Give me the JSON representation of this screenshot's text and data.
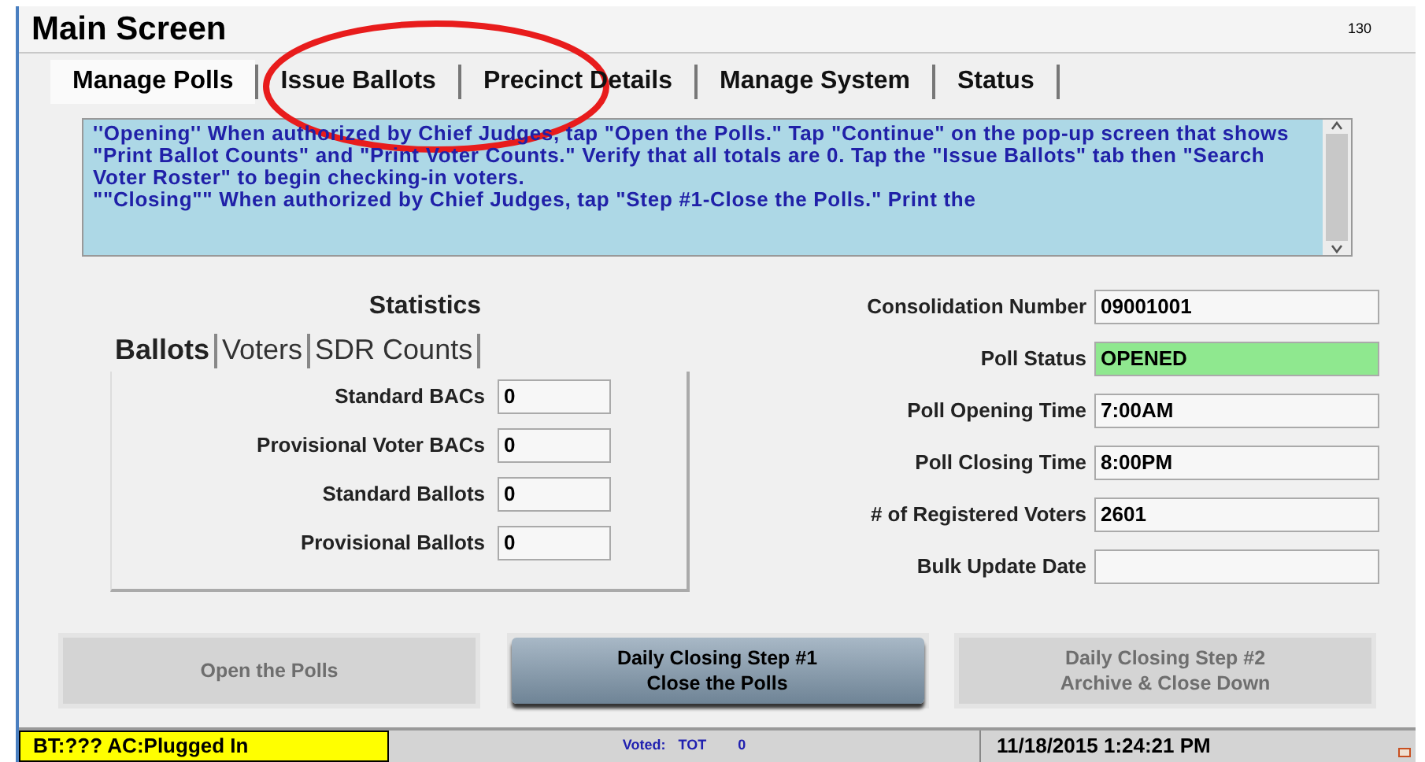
{
  "window": {
    "title": "Main Screen",
    "code": "130"
  },
  "tabs": [
    {
      "label": "Manage Polls",
      "selected": true
    },
    {
      "label": "Issue Ballots",
      "selected": false
    },
    {
      "label": "Precinct Details",
      "selected": false
    },
    {
      "label": "Manage System",
      "selected": false
    },
    {
      "label": "Status",
      "selected": false
    }
  ],
  "instructions": [
    "''Opening'' When authorized by Chief Judges, tap \"Open the Polls.\"  Tap \"Continue\" on the pop-up screen that shows \"Print Ballot Counts\" and \"Print Voter Counts.\"  Verify that all totals are 0.  Tap the \"Issue Ballots\" tab then \"Search Voter Roster\" to begin checking-in voters.",
    "\"\"Closing\"\" When authorized by Chief Judges, tap \"Step #1-Close the Polls.\"  Print the"
  ],
  "statistics": {
    "title": "Statistics",
    "tabs": [
      {
        "label": "Ballots",
        "selected": true
      },
      {
        "label": "Voters",
        "selected": false
      },
      {
        "label": "SDR Counts",
        "selected": false
      }
    ],
    "fields": [
      {
        "label": "Standard BACs",
        "value": "0"
      },
      {
        "label": "Provisional Voter BACs",
        "value": "0"
      },
      {
        "label": "Standard Ballots",
        "value": "0"
      },
      {
        "label": "Provisional Ballots",
        "value": "0"
      }
    ]
  },
  "details": [
    {
      "label": "Consolidation Number",
      "value": "09001001",
      "highlighted": false
    },
    {
      "label": "Poll Status",
      "value": "OPENED",
      "highlighted": true
    },
    {
      "label": "Poll Opening Time",
      "value": "7:00AM",
      "highlighted": false
    },
    {
      "label": "Poll Closing Time",
      "value": "8:00PM",
      "highlighted": false
    },
    {
      "label": "# of Registered Voters",
      "value": "2601",
      "highlighted": false
    },
    {
      "label": "Bulk Update Date",
      "highlighted": false
    }
  ],
  "buttons": [
    {
      "lines": [
        "Open the Polls"
      ],
      "disabled": true
    },
    {
      "lines": [
        "Daily Closing Step #1",
        "Close the Polls"
      ],
      "disabled": false
    },
    {
      "lines": [
        "Daily Closing Step #2",
        "Archive & Close Down"
      ],
      "disabled": true
    }
  ],
  "status_bar": {
    "power": "BT:??? AC:Plugged In",
    "voted_label": "Voted:",
    "voted_type": "TOT",
    "voted_count": "0",
    "datetime": "11/18/2015 1:24:21 PM"
  }
}
